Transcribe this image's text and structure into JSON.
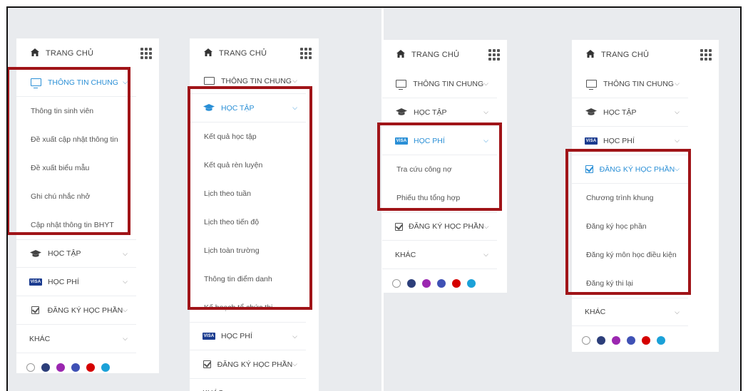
{
  "colors": {
    "highlight": "#a01418",
    "active": "#2a8fd6",
    "swatches": [
      "#ffffff",
      "#2c3e7a",
      "#9b27b0",
      "#3f51b5",
      "#d50000",
      "#1ba1d8"
    ]
  },
  "nav": {
    "home": "TRANG CHỦ",
    "general_info": "THÔNG TIN CHUNG",
    "study": "HỌC TẬP",
    "fees": "HỌC PHÍ",
    "course_registration": "ĐĂNG KÝ HỌC PHẦN",
    "other": "KHÁC",
    "visa_badge": "VISA"
  },
  "general_info_items": [
    "Thông tin sinh viên",
    "Đề xuất cập nhật thông tin",
    "Đề xuất biểu mẫu",
    "Ghi chú nhắc nhở",
    "Cập nhật thông tin BHYT"
  ],
  "study_items": [
    "Kết quả học tập",
    "Kết quả rèn luyện",
    "Lịch theo tuần",
    "Lịch theo tiến độ",
    "Lịch toàn trường",
    "Thông tin điểm danh",
    "Kế hoạch tổ chức thi"
  ],
  "fee_items": [
    "Tra cứu công nợ",
    "Phiếu thu tổng hợp"
  ],
  "registration_items": [
    "Chương trình khung",
    "Đăng ký học phần",
    "Đăng ký môn học điều kiện",
    "Đăng ký thi lại"
  ]
}
